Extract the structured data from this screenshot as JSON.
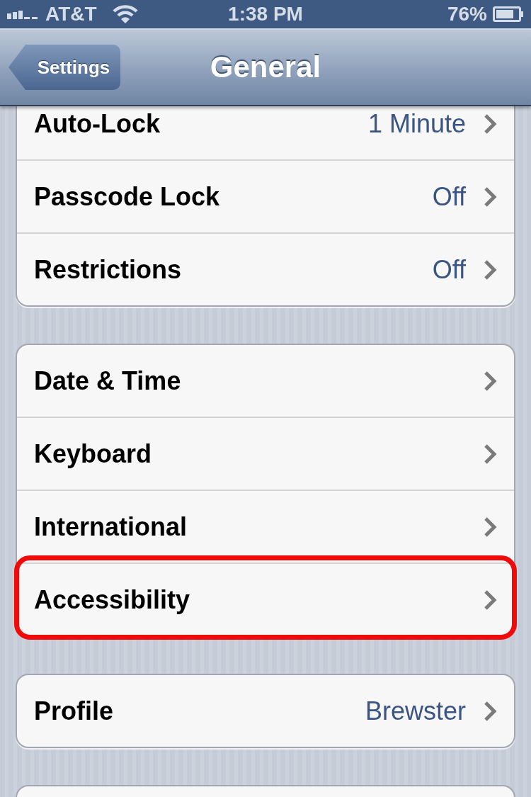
{
  "status_bar": {
    "carrier": "AT&T",
    "time": "1:38 PM",
    "battery": "76%"
  },
  "nav_bar": {
    "back_button": "Settings",
    "title": "General"
  },
  "groups": [
    {
      "top_hidden": true,
      "bottom_hidden": false,
      "rows": [
        {
          "label": "Auto-Lock",
          "value": "1 Minute",
          "highlighted": false
        },
        {
          "label": "Passcode Lock",
          "value": "Off",
          "highlighted": false
        },
        {
          "label": "Restrictions",
          "value": "Off",
          "highlighted": false
        }
      ]
    },
    {
      "top_hidden": false,
      "bottom_hidden": false,
      "rows": [
        {
          "label": "Date & Time",
          "highlighted": false
        },
        {
          "label": "Keyboard",
          "highlighted": false
        },
        {
          "label": "International",
          "highlighted": false
        },
        {
          "label": "Accessibility",
          "highlighted": true
        }
      ]
    },
    {
      "top_hidden": false,
      "bottom_hidden": false,
      "rows": [
        {
          "label": "Profile",
          "value": "Brewster",
          "highlighted": false
        }
      ]
    },
    {
      "top_hidden": false,
      "bottom_hidden": true
    }
  ]
}
